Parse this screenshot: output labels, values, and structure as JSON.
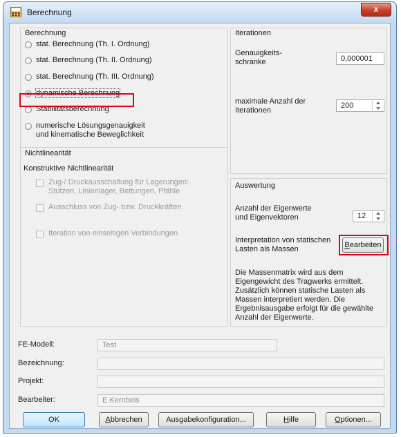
{
  "window": {
    "title": "Berechnung",
    "close_glyph": "x"
  },
  "calc_group": {
    "title": "Berechnung",
    "options": [
      "stat. Berechnung (Th. I. Ordnung)",
      "stat. Berechnung (Th. II. Ordnung)",
      "stat. Berechnung (Th. III. Ordnung)",
      "dynamische Berechnung",
      "Stabilitätsberechnung",
      "numerische Lösungsgenauigkeit",
      "und kinematische Beweglichkeit"
    ],
    "selected_index": 3
  },
  "nonlinear": {
    "title": "Nichtlinearität",
    "subtitle": "Konstruktive Nichtlinearität",
    "opt1_line1": "Zug-/ Druckausschaltung für Lagerungen:",
    "opt1_line2": "Stützen, Linienlager, Bettungen, Pfähle",
    "opt2": "Ausschluss von Zug- bzw. Druckkräften",
    "opt3": "Iteration von einseitigen Verbindungen"
  },
  "iterations": {
    "title": "Iterationen",
    "tol_label_1": "Genauigkeits-",
    "tol_label_2": "schranke",
    "tol_value": "0,000001",
    "max_label_1": "maximale Anzahl der",
    "max_label_2": "Iterationen",
    "max_value": "200"
  },
  "evaluation": {
    "title": "Auswertung",
    "eigen_label_1": "Anzahl der Eigenwerte",
    "eigen_label_2": "und Eigenvektoren",
    "eigen_value": "12",
    "interp_label_1": "Interpretation von statischen",
    "interp_label_2": "Lasten als Massen",
    "edit_button": "Bearbeiten",
    "description": [
      "Die Massenmatrix wird aus dem",
      "Eigengewicht des Tragwerks ermittelt.",
      "Zusätzlich können statische Lasten als",
      "Massen interpretiert werden. Die",
      "Ergebnisausgabe erfolgt für die gewählte",
      "Anzahl der Eigenwerte."
    ]
  },
  "info": {
    "fe_label": "FE-Modell:",
    "fe_value": "Test",
    "desc_label": "Bezeichnung:",
    "desc_value": "",
    "project_label": "Projekt:",
    "project_value": "",
    "editor_label": "Bearbeiter:",
    "editor_value": "E.Kernbeis"
  },
  "buttons": {
    "ok": "OK",
    "cancel": "Abbrechen",
    "output": "Ausgabekonfiguration...",
    "help": "Hilfe",
    "options": "Optionen..."
  },
  "colors": {
    "highlight": "#e2001a",
    "title_bar": "#c6dbf1",
    "close_button": "#c6412a"
  }
}
